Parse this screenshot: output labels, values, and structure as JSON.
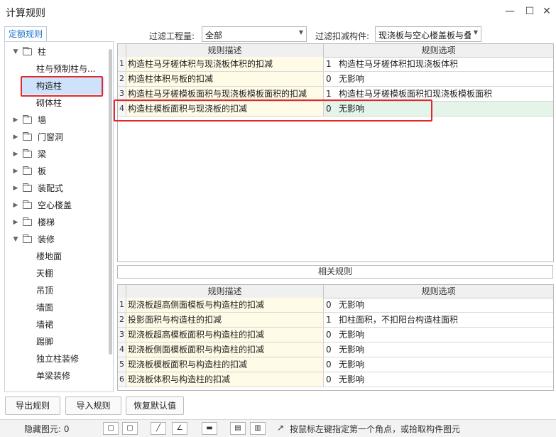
{
  "window": {
    "title": "计算规则",
    "minimize_glyph": "—",
    "maximize_glyph": "☐",
    "close_glyph": "✕"
  },
  "tab": {
    "label": "定额规则"
  },
  "tree": {
    "items": [
      {
        "label": "柱",
        "expanded": true,
        "level": 0
      },
      {
        "label": "柱与预制柱与...",
        "level": 1
      },
      {
        "label": "构造柱",
        "level": 1,
        "selected": true
      },
      {
        "label": "砌体柱",
        "level": 1
      },
      {
        "label": "墙",
        "level": 0
      },
      {
        "label": "门窗洞",
        "level": 0
      },
      {
        "label": "梁",
        "level": 0
      },
      {
        "label": "板",
        "level": 0
      },
      {
        "label": "装配式",
        "level": 0
      },
      {
        "label": "空心楼盖",
        "level": 0
      },
      {
        "label": "楼梯",
        "level": 0
      },
      {
        "label": "装修",
        "expanded": true,
        "level": 0
      },
      {
        "label": "楼地面",
        "level": 1
      },
      {
        "label": "天棚",
        "level": 1
      },
      {
        "label": "吊顶",
        "level": 1
      },
      {
        "label": "墙面",
        "level": 1
      },
      {
        "label": "墙裙",
        "level": 1
      },
      {
        "label": "踢脚",
        "level": 1
      },
      {
        "label": "独立柱装修",
        "level": 1
      },
      {
        "label": "单梁装修",
        "level": 1
      }
    ]
  },
  "filters": {
    "quantity_label": "过滤工程量:",
    "quantity_value": "全部",
    "component_label": "过滤扣减构件:",
    "component_value": "现浇板与空心楼盖板与叠"
  },
  "rules_grid": {
    "headers": {
      "desc": "规则描述",
      "option": "规则选项"
    },
    "rows": [
      {
        "num": "1",
        "desc": "构造柱马牙槎体积与现浇板体积的扣减",
        "code": "1",
        "option": "构造柱马牙槎体积扣现浇板体积"
      },
      {
        "num": "2",
        "desc": "构造柱体积与板的扣减",
        "code": "0",
        "option": "无影响"
      },
      {
        "num": "3",
        "desc": "构造柱马牙槎模板面积与现浇板模板面积的扣减",
        "code": "1",
        "option": "构造柱马牙槎模板面积扣现浇板模板面积"
      },
      {
        "num": "4",
        "desc": "构造柱模板面积与现浇板的扣减",
        "code": "0",
        "option": "无影响"
      }
    ]
  },
  "related": {
    "title": "相关规则",
    "headers": {
      "desc": "规则描述",
      "option": "规则选项"
    },
    "rows": [
      {
        "num": "1",
        "desc": "现浇板超高侧面模板与构造柱的扣减",
        "code": "0",
        "option": "无影响"
      },
      {
        "num": "2",
        "desc": "投影面积与构造柱的扣减",
        "code": "1",
        "option": "扣柱面积，不扣阳台构造柱面积"
      },
      {
        "num": "3",
        "desc": "现浇板超高模板面积与构造柱的扣减",
        "code": "0",
        "option": "无影响"
      },
      {
        "num": "4",
        "desc": "现浇板侧面模板面积与构造柱的扣减",
        "code": "0",
        "option": "无影响"
      },
      {
        "num": "5",
        "desc": "现浇板模板面积与构造柱的扣减",
        "code": "0",
        "option": "无影响"
      },
      {
        "num": "6",
        "desc": "现浇板体积与构造柱的扣减",
        "code": "0",
        "option": "无影响"
      }
    ]
  },
  "buttons": {
    "export": "导出规则",
    "import": "导入规则",
    "restore": "恢复默认值"
  },
  "status_bar": {
    "left_text": "隐藏图元: 0",
    "hint_text": "按鼠标左键指定第一个角点，或拾取构件图元"
  },
  "colors": {
    "highlight_box": "#e02a2a",
    "selected_row": "#e4f4e8",
    "desc_cell": "#fffbe6",
    "tab_text": "#1a73c9"
  }
}
